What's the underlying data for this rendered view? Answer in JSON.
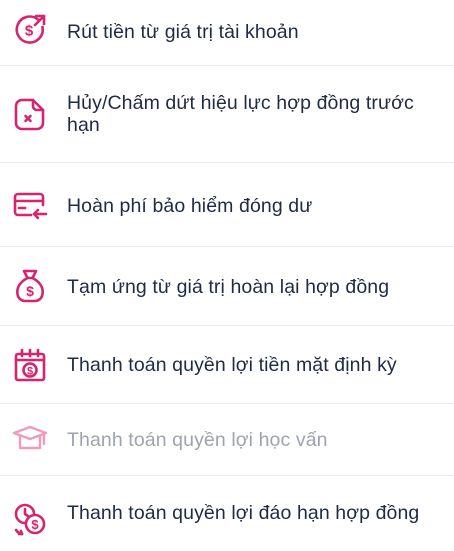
{
  "colors": {
    "accent": "#d6246e",
    "accent_disabled": "#ef9bbd",
    "text": "#1f2a44",
    "text_disabled": "#9da3b0",
    "divider": "#e9ebf0"
  },
  "menu": {
    "items": [
      {
        "label": "Rút tiền từ giá trị tài khoản",
        "icon": "withdraw-money-icon",
        "enabled": true
      },
      {
        "label": "Hủy/Chấm dứt hiệu lực hợp đồng trước hạn",
        "icon": "cancel-document-icon",
        "enabled": true
      },
      {
        "label": "Hoàn phí bảo hiểm đóng dư",
        "icon": "card-refund-icon",
        "enabled": true
      },
      {
        "label": "Tạm ứng từ giá trị hoàn lại hợp đồng",
        "icon": "money-bag-icon",
        "enabled": true
      },
      {
        "label": "Thanh toán quyền lợi tiền mặt định kỳ",
        "icon": "calendar-dollar-icon",
        "enabled": true
      },
      {
        "label": "Thanh toán quyền lợi học vấn",
        "icon": "graduation-cap-icon",
        "enabled": false
      },
      {
        "label": "Thanh toán quyền lợi đáo hạn hợp đồng",
        "icon": "maturity-payment-icon",
        "enabled": true
      }
    ]
  }
}
